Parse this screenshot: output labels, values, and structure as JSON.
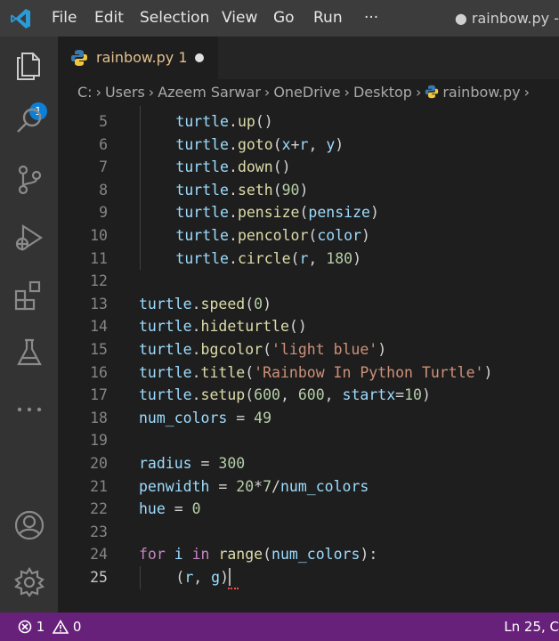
{
  "titlebar": {
    "menu": [
      "File",
      "Edit",
      "Selection",
      "View",
      "Go",
      "Run",
      "···"
    ],
    "window_title": "● rainbow.py - "
  },
  "activitybar": {
    "explorer_badge": "1",
    "icons": [
      "files-icon",
      "search-icon",
      "source-control-icon",
      "run-debug-icon",
      "extensions-icon",
      "testing-icon",
      "more-icon",
      "account-icon",
      "settings-gear-icon"
    ]
  },
  "tab": {
    "label": "rainbow.py 1",
    "modified": true
  },
  "breadcrumb": [
    "C:",
    "Users",
    "Azeem Sarwar",
    "OneDrive",
    "Desktop",
    "rainbow.py"
  ],
  "editor": {
    "lines": [
      {
        "n": "5",
        "code": "    turtle.up()"
      },
      {
        "n": "6",
        "code": "    turtle.goto(x+r, y)"
      },
      {
        "n": "7",
        "code": "    turtle.down()"
      },
      {
        "n": "8",
        "code": "    turtle.seth(90)"
      },
      {
        "n": "9",
        "code": "    turtle.pensize(pensize)"
      },
      {
        "n": "10",
        "code": "    turtle.pencolor(color)"
      },
      {
        "n": "11",
        "code": "    turtle.circle(r, 180)"
      },
      {
        "n": "12",
        "code": ""
      },
      {
        "n": "13",
        "code": "turtle.speed(0)"
      },
      {
        "n": "14",
        "code": "turtle.hideturtle()"
      },
      {
        "n": "15",
        "code": "turtle.bgcolor('light blue')"
      },
      {
        "n": "16",
        "code": "turtle.title('Rainbow In Python Turtle')"
      },
      {
        "n": "17",
        "code": "turtle.setup(600, 600, startx=10)"
      },
      {
        "n": "18",
        "code": "num_colors = 49"
      },
      {
        "n": "19",
        "code": ""
      },
      {
        "n": "20",
        "code": "radius = 300"
      },
      {
        "n": "21",
        "code": "penwidth = 20*7/num_colors"
      },
      {
        "n": "22",
        "code": "hue = 0"
      },
      {
        "n": "23",
        "code": ""
      },
      {
        "n": "24",
        "code": "for i in range(num_colors):"
      },
      {
        "n": "25",
        "code": "    (r, g)"
      }
    ]
  },
  "statusbar": {
    "errors": "1",
    "warnings": "0",
    "position": "Ln 25, C"
  },
  "colors": {
    "statusbar": "#68217a",
    "titlebar": "#3c3c3c",
    "activitybar": "#333333",
    "editor": "#1e1e1e"
  }
}
